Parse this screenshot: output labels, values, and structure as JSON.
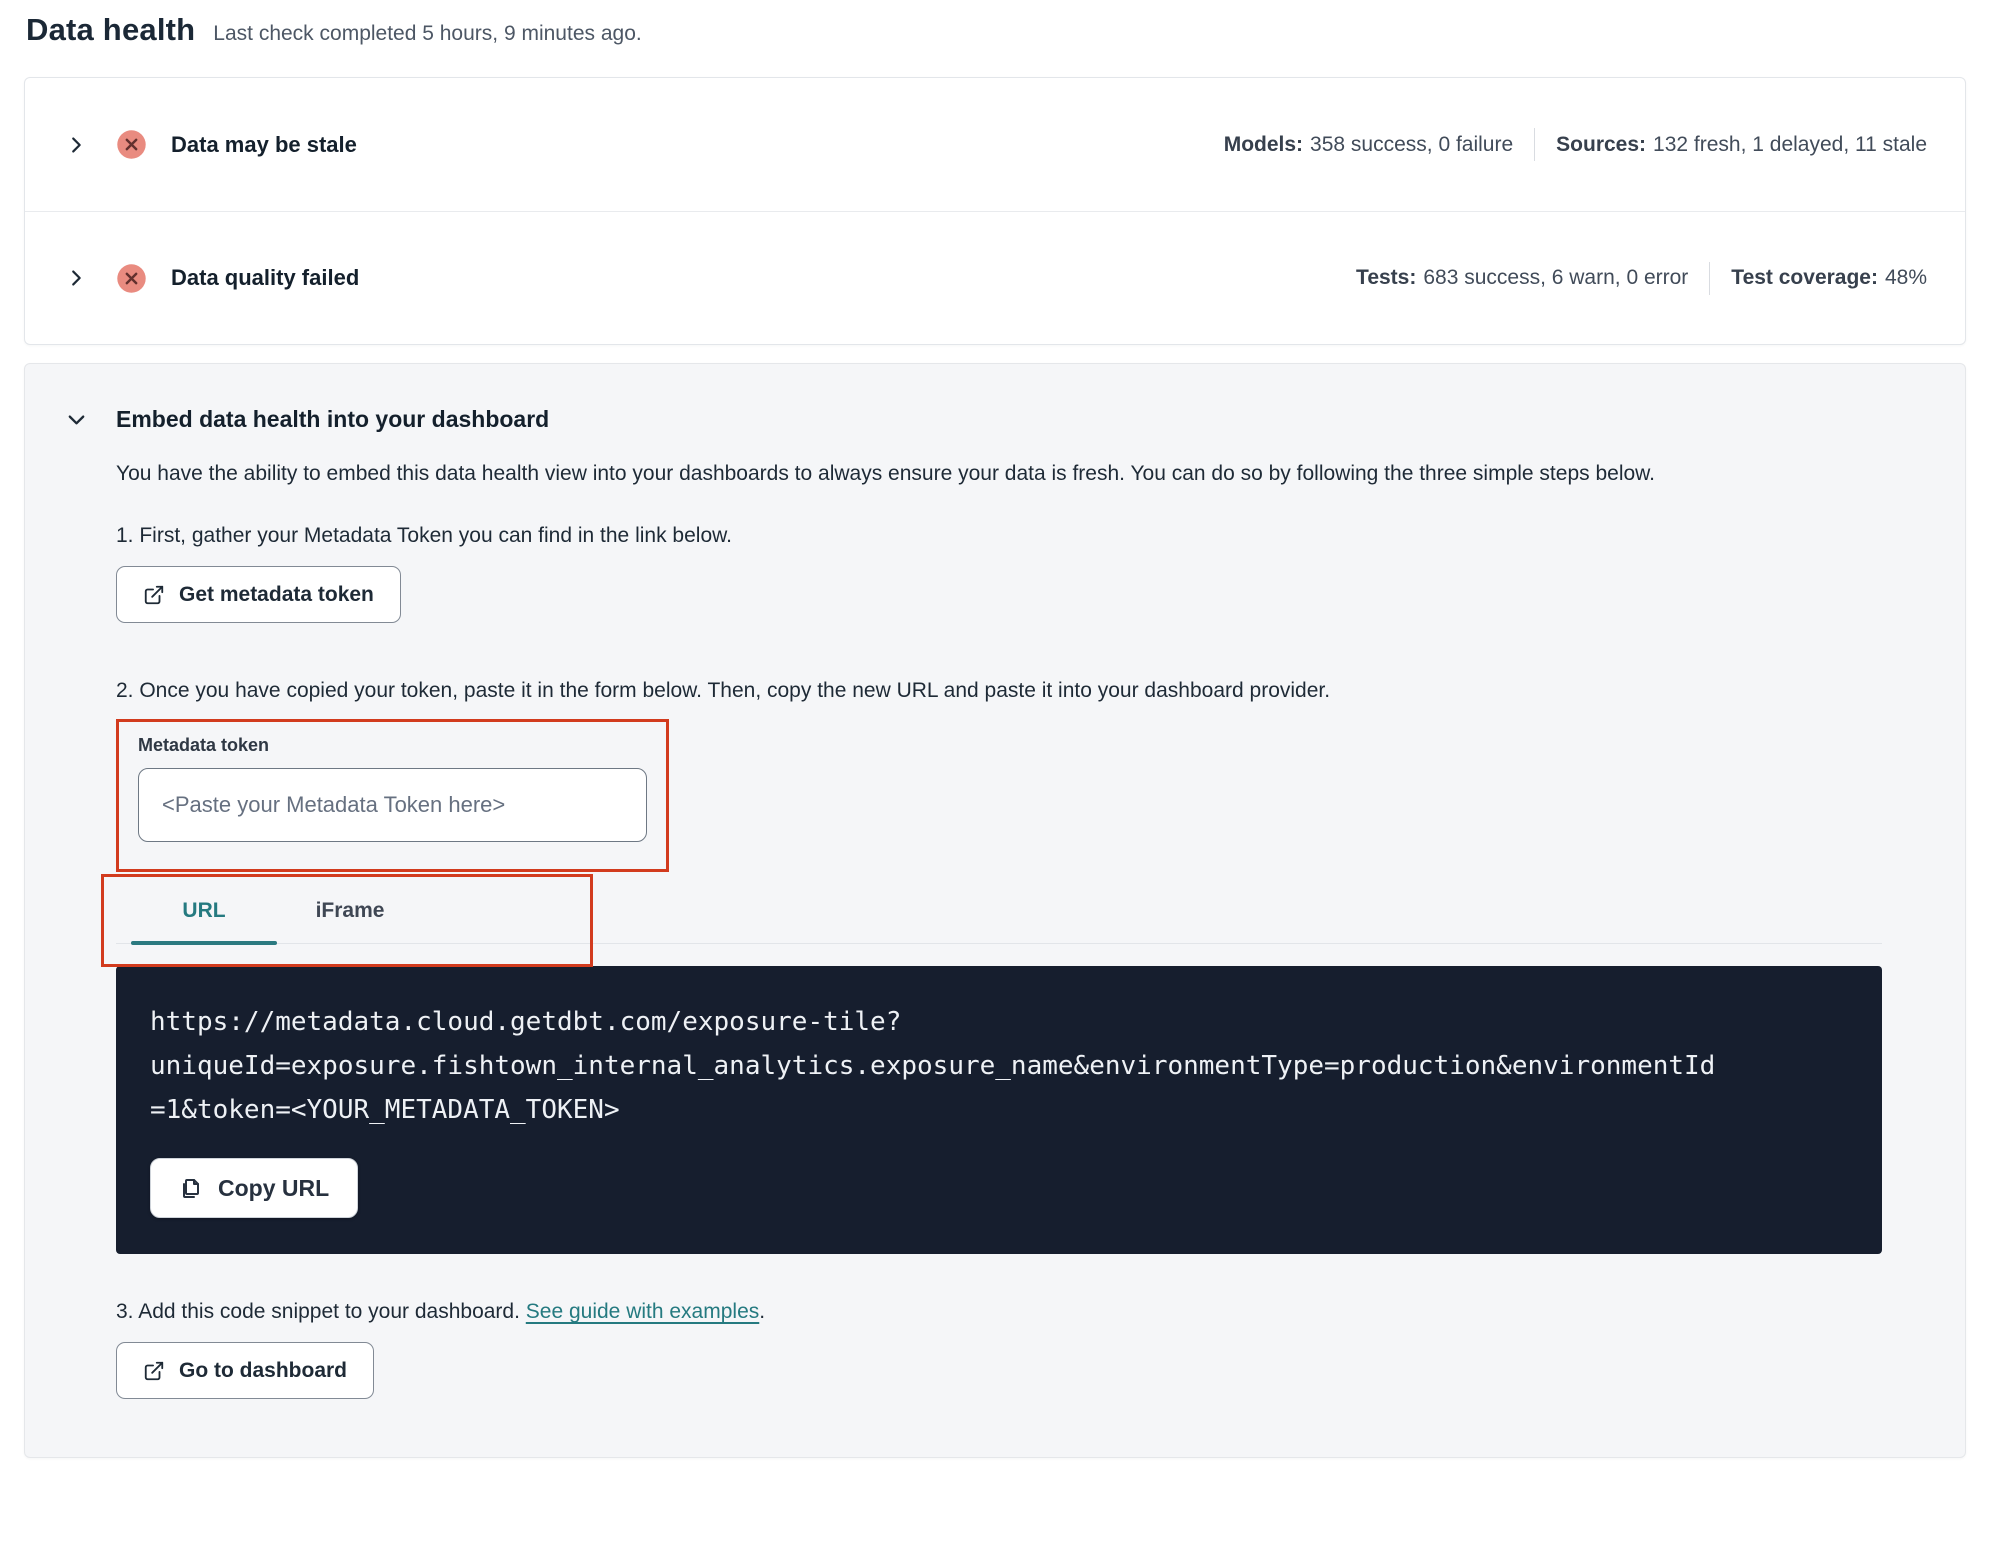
{
  "page": {
    "title": "Data health",
    "subtitle": "Last check completed 5 hours, 9 minutes ago."
  },
  "status_rows": [
    {
      "title": "Data may be stale",
      "status_icon": "error-x-circle",
      "stats": [
        {
          "label": "Models:",
          "value": "358 success, 0 failure"
        },
        {
          "label": "Sources:",
          "value": "132 fresh, 1 delayed, 11 stale"
        }
      ]
    },
    {
      "title": "Data quality failed",
      "status_icon": "error-x-circle",
      "stats": [
        {
          "label": "Tests:",
          "value": "683 success, 6 warn, 0 error"
        },
        {
          "label": "Test coverage:",
          "value": "48%"
        }
      ]
    }
  ],
  "embed": {
    "title": "Embed data health into your dashboard",
    "description": "You have the ability to embed this data health view into your dashboards to always ensure your data is fresh. You can do so by following the three simple steps below.",
    "step1": "1. First, gather your Metadata Token you can find in the link below.",
    "get_token_button": "Get metadata token",
    "step2": "2. Once you have copied your token, paste it in the form below. Then, copy the new URL and paste it into your dashboard provider.",
    "token_field": {
      "label": "Metadata token",
      "placeholder": "<Paste your Metadata Token here>"
    },
    "tabs": [
      {
        "label": "URL",
        "active": true
      },
      {
        "label": "iFrame",
        "active": false
      }
    ],
    "code_url": "https://metadata.cloud.getdbt.com/exposure-tile?uniqueId=exposure.fishtown_internal_analytics.exposure_name&environmentType=production&environmentId=1&token=<YOUR_METADATA_TOKEN>",
    "code_url_lines": [
      "https://metadata.cloud.getdbt.com/exposure-tile?",
      "uniqueId=exposure.fishtown_internal_analytics.exposure_name&environmentType=production&environmentId",
      "=1&token=<YOUR_METADATA_TOKEN>"
    ],
    "copy_button": "Copy URL",
    "step3_prefix": "3. Add this code snippet to your dashboard. ",
    "step3_link": "See guide with examples",
    "step3_suffix": ".",
    "dashboard_button": "Go to dashboard"
  },
  "colors": {
    "accent_teal": "#257a80",
    "annotation_red": "#d23b1e",
    "error_badge_bg": "#e98b80",
    "error_badge_x": "#63302e",
    "code_block_bg": "#161e2e"
  }
}
